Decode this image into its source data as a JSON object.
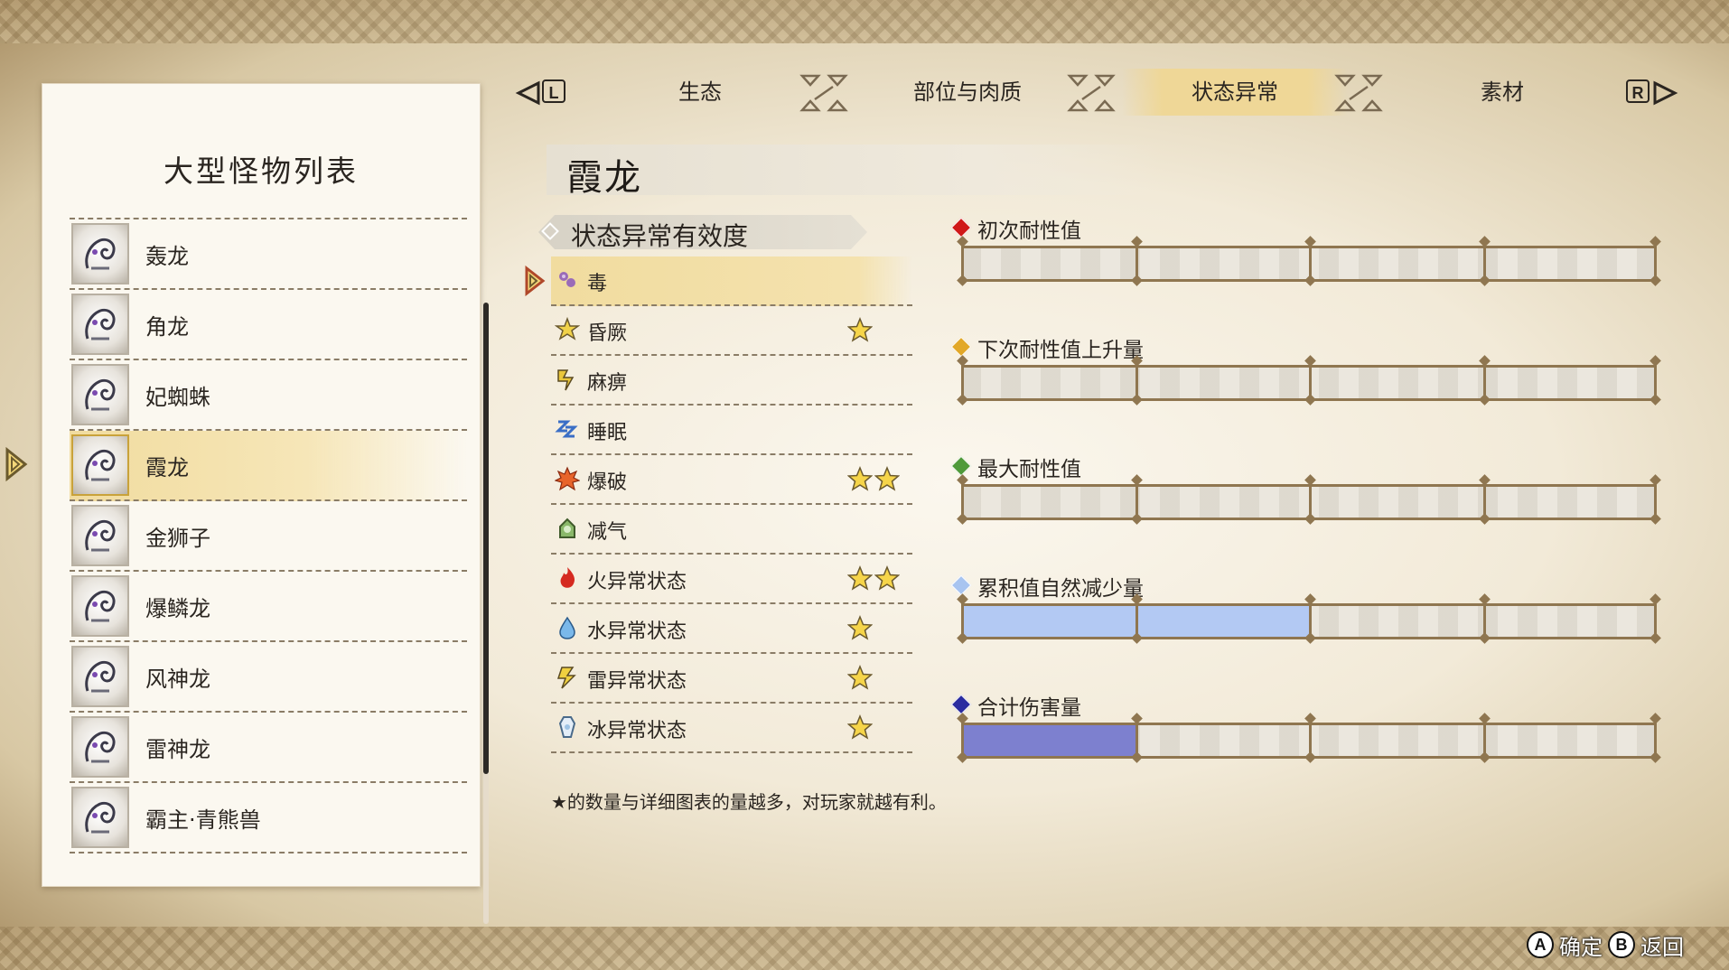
{
  "left_panel": {
    "title": "大型怪物列表",
    "monsters": [
      {
        "name": "轰龙",
        "selected": false,
        "icon": "tigrex-icon"
      },
      {
        "name": "角龙",
        "selected": false,
        "icon": "diablos-icon"
      },
      {
        "name": "妃蜘蛛",
        "selected": false,
        "icon": "rakna-kadaki-icon"
      },
      {
        "name": "霞龙",
        "selected": true,
        "icon": "chameleos-icon"
      },
      {
        "name": "金狮子",
        "selected": false,
        "icon": "rajang-icon"
      },
      {
        "name": "爆鳞龙",
        "selected": false,
        "icon": "bazelgeuse-icon"
      },
      {
        "name": "风神龙",
        "selected": false,
        "icon": "ibushi-icon"
      },
      {
        "name": "雷神龙",
        "selected": false,
        "icon": "narwa-icon"
      },
      {
        "name": "霸主·青熊兽",
        "selected": false,
        "icon": "apex-arzuros-icon"
      }
    ]
  },
  "tabs": {
    "left_key": "L",
    "right_key": "R",
    "items": [
      {
        "label": "生态",
        "active": false
      },
      {
        "label": "部位与肉质",
        "active": false
      },
      {
        "label": "状态异常",
        "active": true
      },
      {
        "label": "素材",
        "active": false
      }
    ]
  },
  "monster_name": "霞龙",
  "effectiveness": {
    "header": "状态异常有效度",
    "rows": [
      {
        "name": "毒",
        "stars": 0,
        "icon": "poison-icon",
        "selected": true
      },
      {
        "name": "昏厥",
        "stars": 1,
        "icon": "stun-icon",
        "selected": false
      },
      {
        "name": "麻痹",
        "stars": 0,
        "icon": "paralysis-icon",
        "selected": false
      },
      {
        "name": "睡眠",
        "stars": 0,
        "icon": "sleep-icon",
        "selected": false
      },
      {
        "name": "爆破",
        "stars": 2,
        "icon": "blast-icon",
        "selected": false
      },
      {
        "name": "减气",
        "stars": 0,
        "icon": "exhaust-icon",
        "selected": false
      },
      {
        "name": "火异常状态",
        "stars": 2,
        "icon": "fireblight-icon",
        "selected": false
      },
      {
        "name": "水异常状态",
        "stars": 1,
        "icon": "waterblight-icon",
        "selected": false
      },
      {
        "name": "雷异常状态",
        "stars": 1,
        "icon": "thunderblight-icon",
        "selected": false
      },
      {
        "name": "冰异常状态",
        "stars": 1,
        "icon": "iceblight-icon",
        "selected": false
      }
    ],
    "footnote": "★的数量与详细图表的量越多，对玩家就越有利。"
  },
  "gauges": [
    {
      "label": "初次耐性值",
      "color": "#d01818",
      "fill_color": "#b9c7ee",
      "level_segments": 0
    },
    {
      "label": "下次耐性值上升量",
      "color": "#e2a828",
      "fill_color": "#b9c7ee",
      "level_segments": 0
    },
    {
      "label": "最大耐性值",
      "color": "#4f9a3a",
      "fill_color": "#b9c7ee",
      "level_segments": 0
    },
    {
      "label": "累积值自然减少量",
      "color": "#a8c4f0",
      "fill_color": "#b3c9f3",
      "level_segments": 2
    },
    {
      "label": "合计伤害量",
      "color": "#2b2ca0",
      "fill_color": "#7d80cf",
      "level_segments": 1
    }
  ],
  "controls": {
    "confirm_key": "A",
    "confirm_label": "确定",
    "back_key": "B",
    "back_label": "返回"
  },
  "colors": {
    "highlight": "#f1dc9f",
    "star": "#f6d54a",
    "frame_brown": "#8f7650"
  }
}
